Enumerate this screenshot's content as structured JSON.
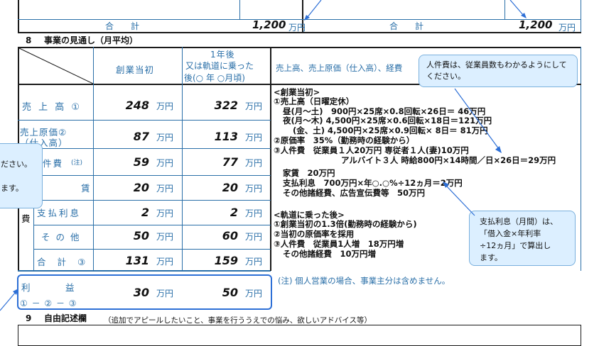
{
  "top_table": {
    "left_total_label": "合　計",
    "left_total_value": "1,200",
    "left_total_unit": "万円",
    "right_total_label": "合　計",
    "right_total_value": "1,200",
    "right_total_unit": "万円"
  },
  "section8": {
    "number": "8",
    "title": "事業の見通し（月平均）",
    "col_start": "創業当初",
    "col_later_line1": "1年後",
    "col_later_line2": "又は軌道に乗った",
    "col_later_line3": "後(○ 年 ○月頃)",
    "col_basis": "売上高、売上原価（仕入高）、経費",
    "unit": "万円",
    "rows": [
      {
        "label": "売 上 高 ①",
        "start": "248",
        "later": "322"
      },
      {
        "label": "売上原価②（仕入高）",
        "label_l1": "売上原価②",
        "label_l2": "（仕入高）",
        "start": "87",
        "later": "113"
      },
      {
        "label": "人件費(注)",
        "label_main": "件費",
        "label_note": "(注)",
        "start": "59",
        "later": "77"
      },
      {
        "label": "家 賃",
        "label_main": "賃",
        "start": "20",
        "later": "20"
      },
      {
        "label": "支払利息",
        "start": "2",
        "later": "2"
      },
      {
        "label": "その他",
        "start": "50",
        "later": "60"
      },
      {
        "label": "合 計 ③",
        "start": "131",
        "later": "159"
      }
    ],
    "expense_label": "費",
    "profit_label_l1": "利　　　益",
    "profit_label_l2": "① － ② － ③",
    "profit_start": "30",
    "profit_later": "50",
    "footnote": "(注) 個人営業の場合、事業主分は含めません。"
  },
  "basis_text": {
    "line1": "<創業当初>",
    "line2": "①売上高（日曜定休）",
    "line3": "昼(月～土)　900円×25席×0.8回転×26日＝ 46万円",
    "line4": "夜(月～木) 4,500円×25席×0.6回転×18日＝121万円",
    "line5": "(金、土) 4,500円×25席×0.9回転× 8日＝ 81万円",
    "line6": "②原価率　35%（勤務時の経験から）",
    "line7": "③人件費　従業員１人20万円 専従者１人(妻)10万円",
    "line8": "アルバイト３人 時給800円×14時間／日×26日＝29万円",
    "line9": "家賃　20万円",
    "line10": "支払利息　700万円×年○.○%÷12ヵ月＝2万円",
    "line11": "その他諸経費、広告宣伝費等　50万円",
    "line12": "<軌道に乗った後>",
    "line13": "①創業当初の1.3倍(勤務時の経験から)",
    "line14": "②当初の原価率を採用",
    "line15": "③人件費　従業員1人増　18万円増",
    "line16": "その他諸経費　10万円増"
  },
  "callouts": {
    "personnel": "人件費は、従業員数もわかるようにしてください。",
    "interest_l1": "支払利息（月間）は、",
    "interest_l2": "「借入金×年利率",
    "interest_l3": "÷12ヵ月」で算出し",
    "interest_l4": "ます。",
    "left_l1": "ださい。",
    "left_l2": "ます。"
  },
  "section9": {
    "number": "9",
    "title": "自由記述欄",
    "subtitle": "（追加でアピールしたいこと、事業を行ううえでの悩み、欲しいアドバイス等）"
  },
  "colors": {
    "line": "#2a6fa8",
    "callout_bg": "#dcefff",
    "highlight": "#2d6fd6"
  }
}
